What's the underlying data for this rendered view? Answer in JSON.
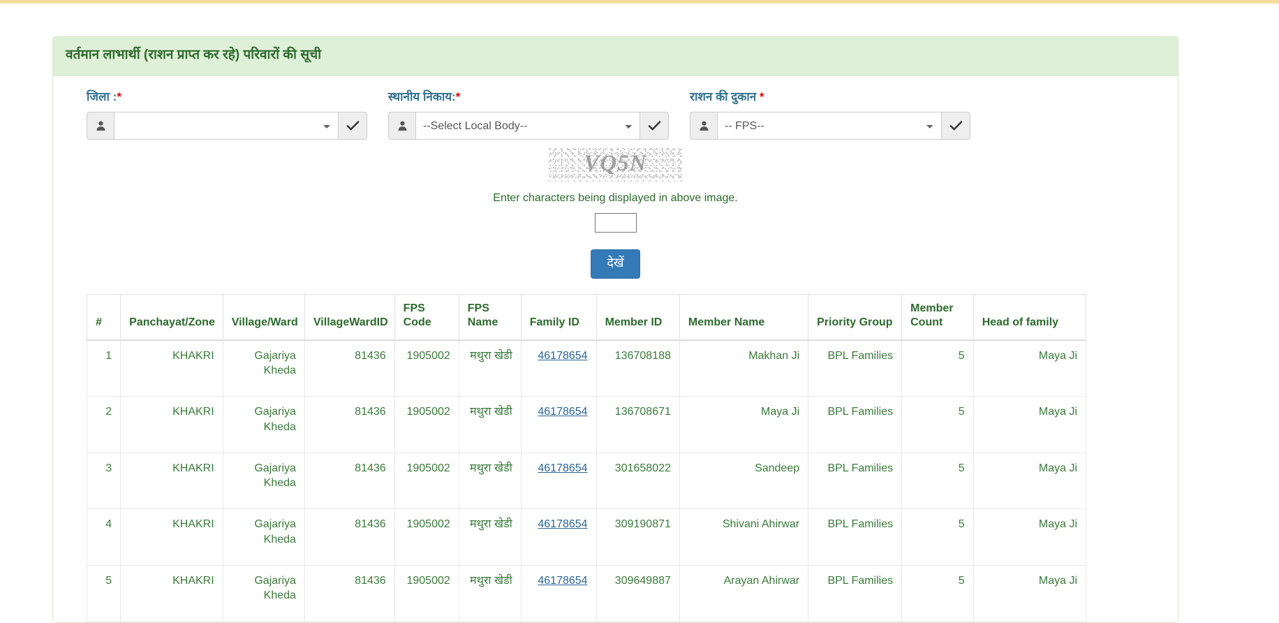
{
  "panel": {
    "title": "वर्तमान लाभार्थी (राशन प्राप्त कर रहे) परिवारों की सूची"
  },
  "form": {
    "fields": [
      {
        "label": "जिला :",
        "required_marker": "*",
        "selected": "",
        "addon_icon": "user-icon",
        "confirm_icon": "check-icon"
      },
      {
        "label": "स्थानीय निकाय:",
        "required_marker": "*",
        "selected": "--Select Local Body--",
        "addon_icon": "user-icon",
        "confirm_icon": "check-icon"
      },
      {
        "label": "राशन की दुकान ",
        "required_marker": "*",
        "selected": "-- FPS--",
        "addon_icon": "user-icon",
        "confirm_icon": "check-icon"
      }
    ]
  },
  "captcha": {
    "text": "VQ5N",
    "instruction": "Enter characters being displayed in above image.",
    "input_value": "",
    "input_placeholder": ""
  },
  "submit": {
    "label": "देखें"
  },
  "table": {
    "headers": [
      "#",
      "Panchayat/Zone",
      "Village/Ward",
      "VillageWardID",
      "FPS Code",
      "FPS Name",
      "Family ID",
      "Member ID",
      "Member Name",
      "Priority Group",
      "Member Count",
      "Head of family"
    ],
    "rows": [
      {
        "index": "1",
        "panchayat": "KHAKRI",
        "village": "Gajariya Kheda",
        "village_ward_id": "81436",
        "fps_code": "1905002",
        "fps_name": "मथुरा खेडी",
        "family_id": "46178654",
        "member_id": "136708188",
        "member_name": "Makhan Ji",
        "priority_group": "BPL Families",
        "member_count": "5",
        "head_of_family": "Maya Ji"
      },
      {
        "index": "2",
        "panchayat": "KHAKRI",
        "village": "Gajariya Kheda",
        "village_ward_id": "81436",
        "fps_code": "1905002",
        "fps_name": "मथुरा खेडी",
        "family_id": "46178654",
        "member_id": "136708671",
        "member_name": "Maya Ji",
        "priority_group": "BPL Families",
        "member_count": "5",
        "head_of_family": "Maya Ji"
      },
      {
        "index": "3",
        "panchayat": "KHAKRI",
        "village": "Gajariya Kheda",
        "village_ward_id": "81436",
        "fps_code": "1905002",
        "fps_name": "मथुरा खेडी",
        "family_id": "46178654",
        "member_id": "301658022",
        "member_name": "Sandeep",
        "priority_group": "BPL Families",
        "member_count": "5",
        "head_of_family": "Maya Ji"
      },
      {
        "index": "4",
        "panchayat": "KHAKRI",
        "village": "Gajariya Kheda",
        "village_ward_id": "81436",
        "fps_code": "1905002",
        "fps_name": "मथुरा खेडी",
        "family_id": "46178654",
        "member_id": "309190871",
        "member_name": "Shivani Ahirwar",
        "priority_group": "BPL Families",
        "member_count": "5",
        "head_of_family": "Maya Ji"
      },
      {
        "index": "5",
        "panchayat": "KHAKRI",
        "village": "Gajariya Kheda",
        "village_ward_id": "81436",
        "fps_code": "1905002",
        "fps_name": "मथुरा खेडी",
        "family_id": "46178654",
        "member_id": "309649887",
        "member_name": "Arayan Ahirwar",
        "priority_group": "BPL Families",
        "member_count": "5",
        "head_of_family": "Maya Ji"
      }
    ]
  },
  "colors": {
    "panel_header_bg": "#dff0d8",
    "panel_border": "#d6e9c6",
    "title_green": "#2d6a2d",
    "label_blue": "#31708f",
    "required_red": "#e60000",
    "primary_button": "#337ab7",
    "link_blue": "#2a6496",
    "top_bar": "#f5dd9b",
    "table_text_green": "#3b7a3b"
  }
}
